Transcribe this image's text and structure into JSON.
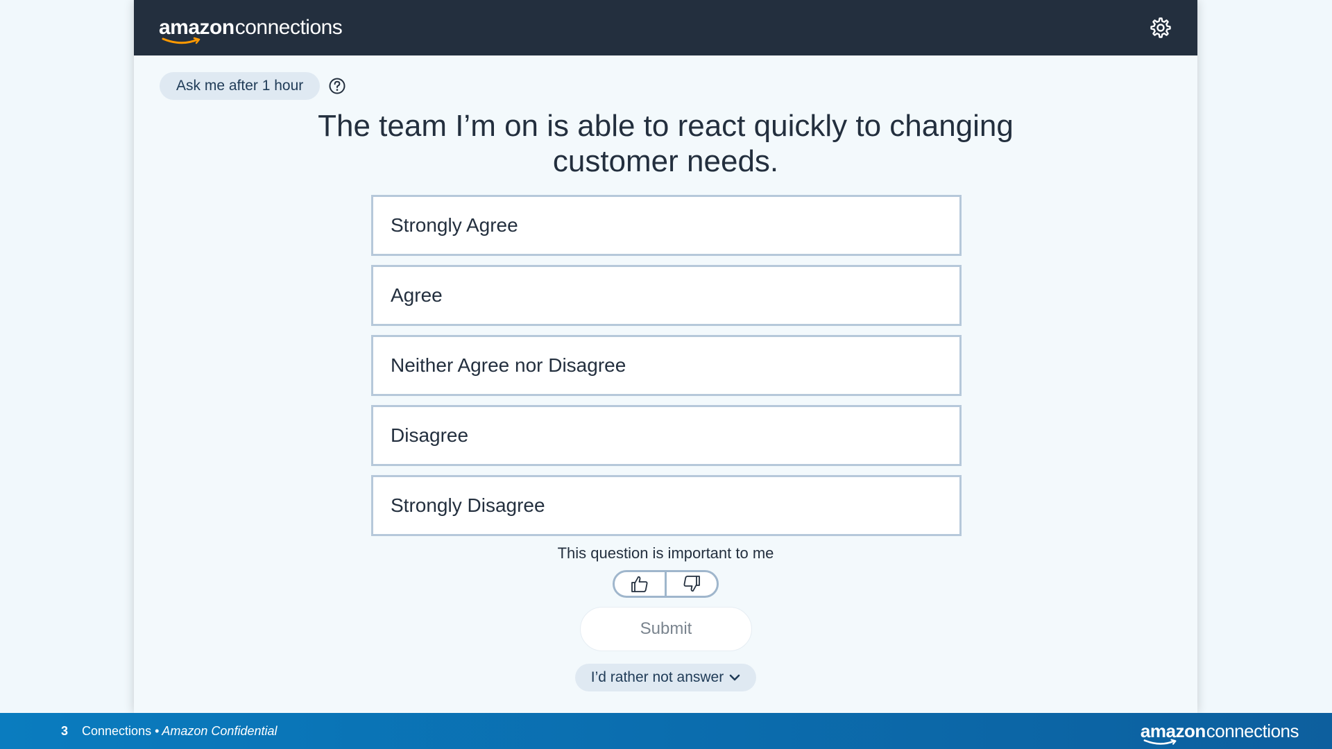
{
  "header": {
    "logo_amazon": "amazon",
    "logo_connections": "connections",
    "settings_icon": "gear-icon"
  },
  "snooze": {
    "label": "Ask me after 1 hour",
    "help_icon": "question-circle-icon"
  },
  "question": {
    "line1": "The team I’m on is able to react quickly to changing",
    "line2": "customer needs."
  },
  "options": [
    {
      "label": "Strongly Agree"
    },
    {
      "label": "Agree"
    },
    {
      "label": "Neither Agree nor Disagree"
    },
    {
      "label": "Disagree"
    },
    {
      "label": "Strongly Disagree"
    }
  ],
  "importance": {
    "label": "This question is important to me",
    "up_icon": "thumbs-up-icon",
    "down_icon": "thumbs-down-icon"
  },
  "submit": {
    "label": "Submit"
  },
  "decline": {
    "label": "I’d rather not answer",
    "icon": "chevron-down-icon"
  },
  "footer": {
    "page_number": "3",
    "text": "Connections •",
    "confidential": "Amazon Confidential",
    "logo_amazon": "amazon",
    "logo_connections": "connections"
  },
  "colors": {
    "header_bg": "#232f3e",
    "page_bg": "#f1f8fc",
    "option_border": "#b6c8da",
    "pill_bg": "#dfe9f2",
    "footer_blue": "#0a7cbf"
  }
}
